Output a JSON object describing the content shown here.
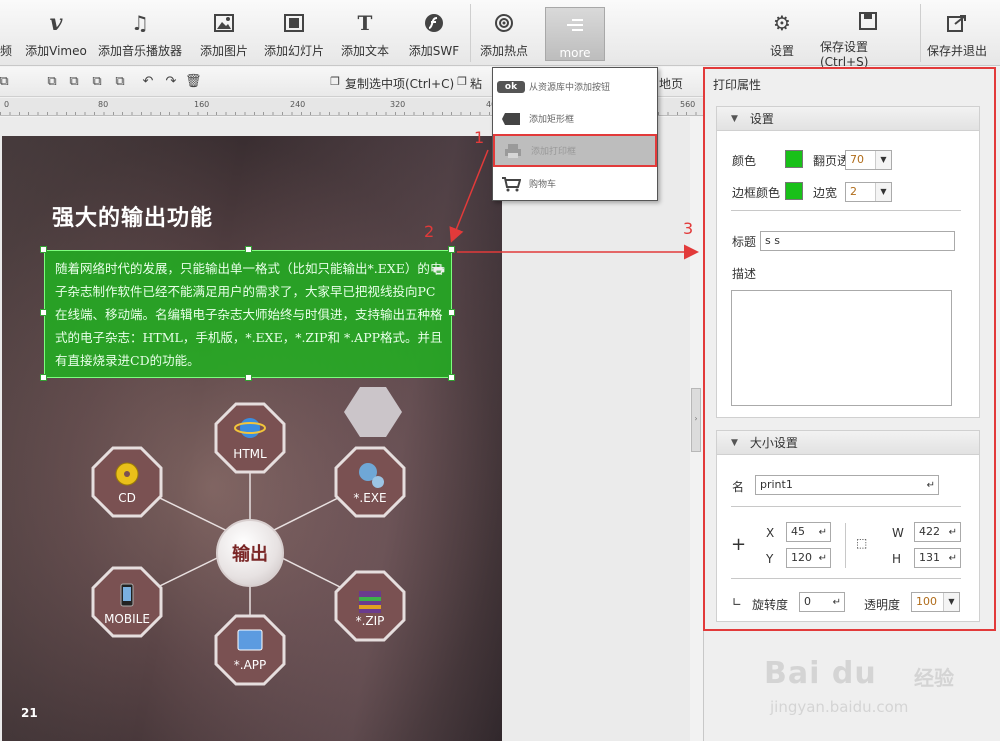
{
  "toolbar": {
    "items": [
      {
        "label": "频",
        "icon": "video-icon"
      },
      {
        "label": "添加Vimeo",
        "icon": "vimeo-icon"
      },
      {
        "label": "添加音乐播放器",
        "icon": "music-icon"
      },
      {
        "label": "添加图片",
        "icon": "image-icon"
      },
      {
        "label": "添加幻灯片",
        "icon": "slideshow-icon"
      },
      {
        "label": "添加文本",
        "icon": "text-icon"
      },
      {
        "label": "添加SWF",
        "icon": "flash-icon"
      },
      {
        "label": "添加热点",
        "icon": "hotspot-icon"
      },
      {
        "label": "more",
        "icon": "more-icon"
      },
      {
        "label": "设置",
        "icon": "gear-icon"
      },
      {
        "label": "保存设置(Ctrl+S)",
        "icon": "save-icon"
      },
      {
        "label": "保存并退出",
        "icon": "exit-icon"
      }
    ]
  },
  "toolbar2": {
    "copy_label": "复制选中项(Ctrl+C)",
    "paste_label": "粘",
    "trailing_label": "地页"
  },
  "ruler": {
    "marks": [
      "0",
      "80",
      "160",
      "240",
      "320",
      "400",
      "480",
      "560"
    ]
  },
  "dropdown": {
    "items": [
      {
        "label": "从资源库中添加按钮",
        "icon": "ok-button-icon",
        "badge": "ok"
      },
      {
        "label": "添加矩形框",
        "icon": "rectangle-icon"
      },
      {
        "label": "添加打印框",
        "icon": "printer-icon"
      },
      {
        "label": "购物车",
        "icon": "cart-icon"
      }
    ]
  },
  "page": {
    "title": "强大的输出功能",
    "page_number": "21",
    "textbox": "随着网络时代的发展，只能输出单一格式（比如只能输出*.EXE）的电子杂志制作软件已经不能满足用户的需求了，大家早已把视线投向PC在线端、移动端。名编辑电子杂志大师始终与时俱进，支持输出五种格式的电子杂志：HTML，手机版，*.EXE，*.ZIP和 *.APP格式。并且有直接烧录进CD的功能。",
    "center_label": "输出",
    "nodes": [
      {
        "label": "HTML",
        "icon": "ie-icon"
      },
      {
        "label": "*.EXE",
        "icon": "gears-icon"
      },
      {
        "label": "CD",
        "icon": "cd-icon"
      },
      {
        "label": "MOBILE",
        "icon": "phone-icon"
      },
      {
        "label": "*.APP",
        "icon": "finder-icon"
      },
      {
        "label": "*.ZIP",
        "icon": "archive-icon"
      }
    ]
  },
  "annotations": {
    "n1": "1",
    "n2": "2",
    "n3": "3"
  },
  "panel": {
    "title": "打印属性",
    "settings": {
      "header": "设置",
      "color_label": "颜色",
      "color_value": "#19c019",
      "flip_label": "翻页透",
      "flip_value": "70",
      "border_color_label": "边框颜色",
      "border_color_value": "#19c019",
      "border_width_label": "边宽",
      "border_width_value": "2",
      "title_label": "标题",
      "title_value": "s s",
      "desc_label": "描述",
      "desc_value": ""
    },
    "size": {
      "header": "大小设置",
      "name_label": "名",
      "name_value": "print1",
      "x_label": "X",
      "x_value": "45",
      "y_label": "Y",
      "y_value": "120",
      "w_label": "W",
      "w_value": "422",
      "h_label": "H",
      "h_value": "131",
      "rotate_label": "旋转度",
      "rotate_value": "0",
      "opacity_label": "透明度",
      "opacity_value": "100"
    }
  },
  "watermark": {
    "logo": "Bai du",
    "cn": "经验",
    "url": "jingyan.baidu.com"
  }
}
